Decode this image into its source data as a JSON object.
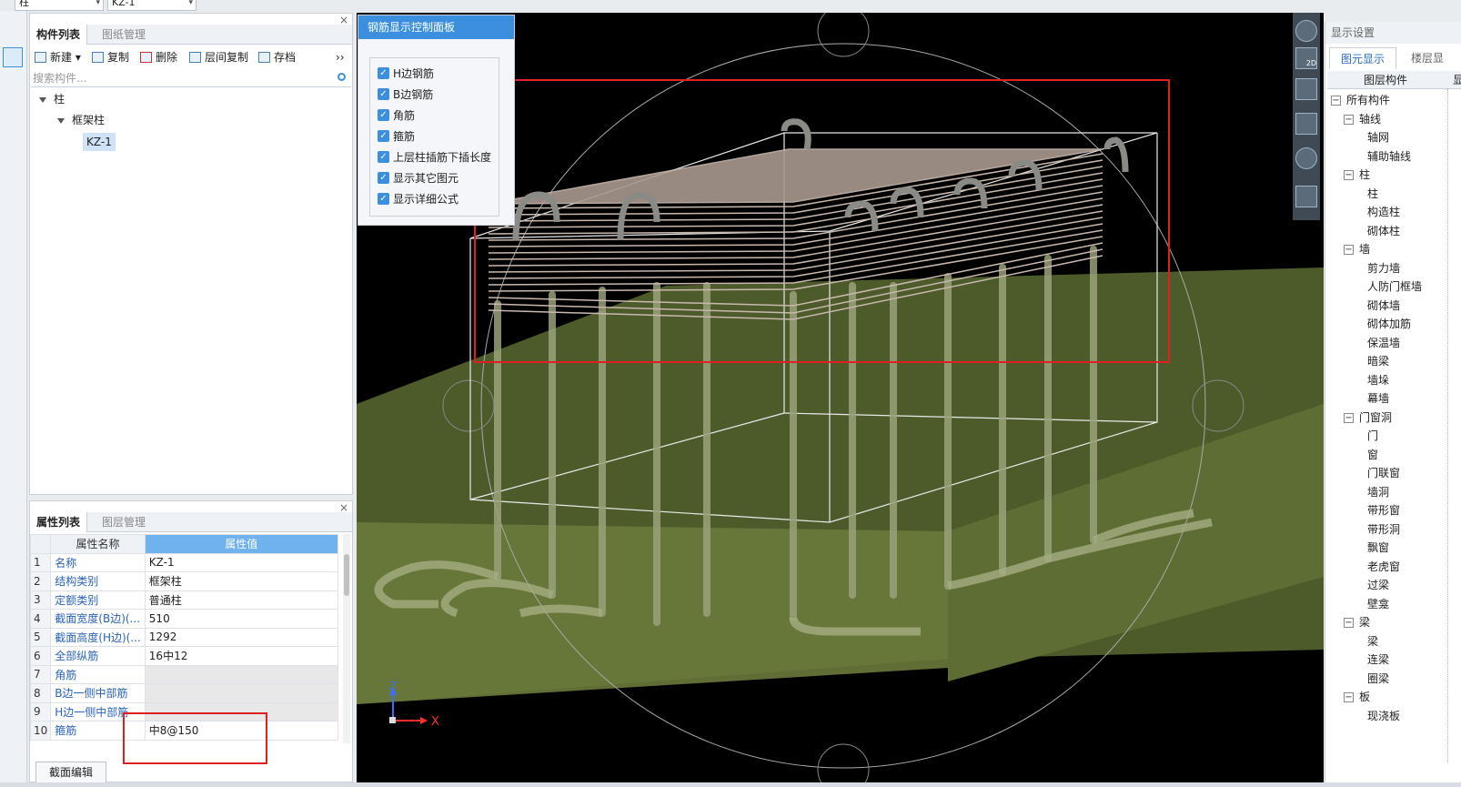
{
  "top": {
    "combo1": "柱",
    "combo2": "KZ-1"
  },
  "component_panel": {
    "tabs": [
      "构件列表",
      "图纸管理"
    ],
    "toolbar": {
      "new": "新建",
      "copy": "复制",
      "delete": "删除",
      "floor_copy": "层间复制",
      "save": "存档",
      "more": "››"
    },
    "search_placeholder": "搜索构件...",
    "tree": {
      "root": "柱",
      "child": "框架柱",
      "leaf": "KZ-1"
    }
  },
  "property_panel": {
    "tabs": [
      "属性列表",
      "图层管理"
    ],
    "col_name": "属性名称",
    "col_value": "属性值",
    "rows": [
      {
        "num": "1",
        "name": "名称",
        "value": "KZ-1"
      },
      {
        "num": "2",
        "name": "结构类别",
        "value": "框架柱"
      },
      {
        "num": "3",
        "name": "定额类别",
        "value": "普通柱"
      },
      {
        "num": "4",
        "name": "截面宽度(B边)(...",
        "value": "510"
      },
      {
        "num": "5",
        "name": "截面高度(H边)(...",
        "value": "1292"
      },
      {
        "num": "6",
        "name": "全部纵筋",
        "value": "16中12"
      },
      {
        "num": "7",
        "name": "角筋",
        "value": ""
      },
      {
        "num": "8",
        "name": "B边一侧中部筋",
        "value": ""
      },
      {
        "num": "9",
        "name": "H边一侧中部筋",
        "value": ""
      },
      {
        "num": "10",
        "name": "箍筋",
        "value": "中8@150"
      }
    ],
    "section_edit": "截面编辑"
  },
  "rebar_panel": {
    "title": "钢筋显示控制面板",
    "options": [
      "H边钢筋",
      "B边钢筋",
      "角筋",
      "箍筋",
      "上层柱插筋下插长度",
      "显示其它图元",
      "显示详细公式"
    ]
  },
  "axis": {
    "z": "Z",
    "x": "X"
  },
  "nav_badge": "2D",
  "display_settings": {
    "title": "显示设置",
    "tabs": [
      "图元显示",
      "楼层显示"
    ],
    "col_header": "图层构件",
    "col_header2": "显",
    "items": [
      {
        "label": "所有构件",
        "level": 0,
        "group": true
      },
      {
        "label": "轴线",
        "level": 1,
        "group": true
      },
      {
        "label": "轴网",
        "level": 2
      },
      {
        "label": "辅助轴线",
        "level": 2
      },
      {
        "label": "柱",
        "level": 1,
        "group": true
      },
      {
        "label": "柱",
        "level": 2
      },
      {
        "label": "构造柱",
        "level": 2
      },
      {
        "label": "砌体柱",
        "level": 2
      },
      {
        "label": "墙",
        "level": 1,
        "group": true
      },
      {
        "label": "剪力墙",
        "level": 2
      },
      {
        "label": "人防门框墙",
        "level": 2
      },
      {
        "label": "砌体墙",
        "level": 2
      },
      {
        "label": "砌体加筋",
        "level": 2
      },
      {
        "label": "保温墙",
        "level": 2
      },
      {
        "label": "暗梁",
        "level": 2
      },
      {
        "label": "墙垛",
        "level": 2
      },
      {
        "label": "幕墙",
        "level": 2
      },
      {
        "label": "门窗洞",
        "level": 1,
        "group": true
      },
      {
        "label": "门",
        "level": 2
      },
      {
        "label": "窗",
        "level": 2
      },
      {
        "label": "门联窗",
        "level": 2
      },
      {
        "label": "墙洞",
        "level": 2
      },
      {
        "label": "带形窗",
        "level": 2
      },
      {
        "label": "带形洞",
        "level": 2
      },
      {
        "label": "飘窗",
        "level": 2
      },
      {
        "label": "老虎窗",
        "level": 2
      },
      {
        "label": "过梁",
        "level": 2
      },
      {
        "label": "壁龛",
        "level": 2
      },
      {
        "label": "梁",
        "level": 1,
        "group": true
      },
      {
        "label": "梁",
        "level": 2
      },
      {
        "label": "连梁",
        "level": 2
      },
      {
        "label": "圈梁",
        "level": 2
      },
      {
        "label": "板",
        "level": 1,
        "group": true
      },
      {
        "label": "现浇板",
        "level": 2
      }
    ]
  },
  "colors": {
    "accent": "#3c8fde",
    "highlight_box": "#e02020",
    "slab": "#5a6b33",
    "rebar": "#c9b8ae"
  }
}
